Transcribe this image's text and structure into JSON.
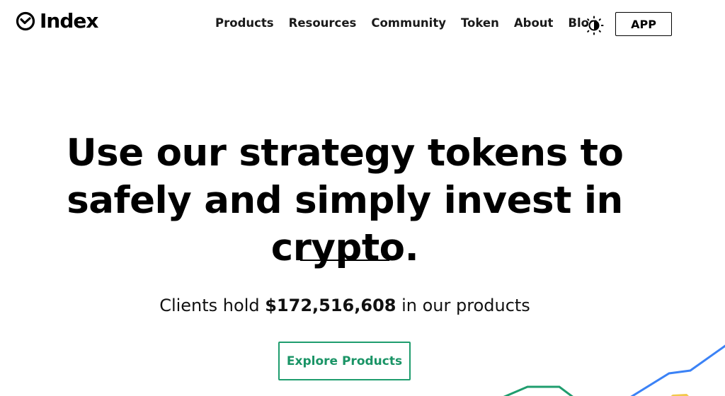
{
  "header": {
    "logo_text": "Index",
    "nav": [
      "Products",
      "Resources",
      "Community",
      "Token",
      "About",
      "Blog"
    ],
    "app_button": "APP"
  },
  "hero": {
    "headline": "Use our strategy tokens to safely and simply invest in crypto.",
    "stat_prefix": "Clients hold ",
    "stat_value": "$172,516,608",
    "stat_suffix": " in our products",
    "cta": "Explore Products"
  },
  "colors": {
    "accent_green": "#1f9d6e",
    "chart_blue": "#3b82f6",
    "chart_yellow": "#f2c94c"
  },
  "icons": {
    "logo": "index-logo-icon",
    "theme": "theme-toggle-icon"
  }
}
